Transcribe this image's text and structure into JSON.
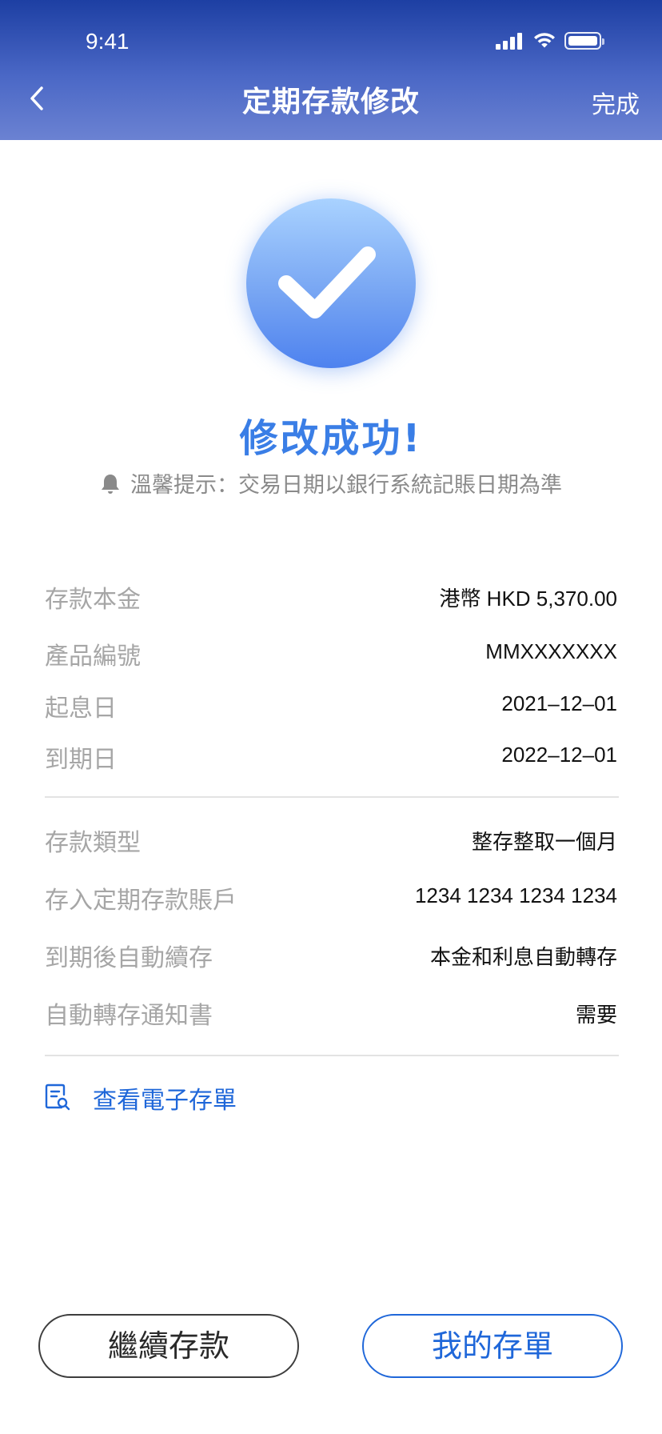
{
  "status_bar": {
    "time": "9:41"
  },
  "header": {
    "title": "定期存款修改",
    "done_label": "完成"
  },
  "result": {
    "title": "修改成功!",
    "tip": "溫馨提示：交易日期以銀行系統記賬日期為準"
  },
  "details": [
    {
      "label": "存款本金",
      "value": "港幣 HKD 5,370.00"
    },
    {
      "label": "產品編號",
      "value": "MMXXXXXXX"
    },
    {
      "label": "起息日",
      "value": "2021–12–01"
    },
    {
      "label": "到期日",
      "value": "2022–12–01"
    },
    {
      "label": "存款類型",
      "value": "整存整取一個月"
    },
    {
      "label": "存入定期存款賬戶",
      "value": "1234 1234 1234 1234"
    },
    {
      "label": "到期後自動續存",
      "value": "本金和利息自動轉存"
    },
    {
      "label": "自動轉存通知書",
      "value": "需要"
    }
  ],
  "link": {
    "view_deposit_receipt": "查看電子存單"
  },
  "buttons": {
    "continue_deposit": "繼續存款",
    "my_deposits": "我的存單"
  },
  "colors": {
    "header_gradient_top": "#1d3fa3",
    "header_gradient_bottom": "#6b82d2",
    "accent_blue": "#1f67d9",
    "success_blue": "#3a7ee6"
  },
  "icons": {
    "back": "chevron-left-icon",
    "success": "checkmark-icon",
    "tip": "bell-icon",
    "document": "document-search-icon"
  }
}
